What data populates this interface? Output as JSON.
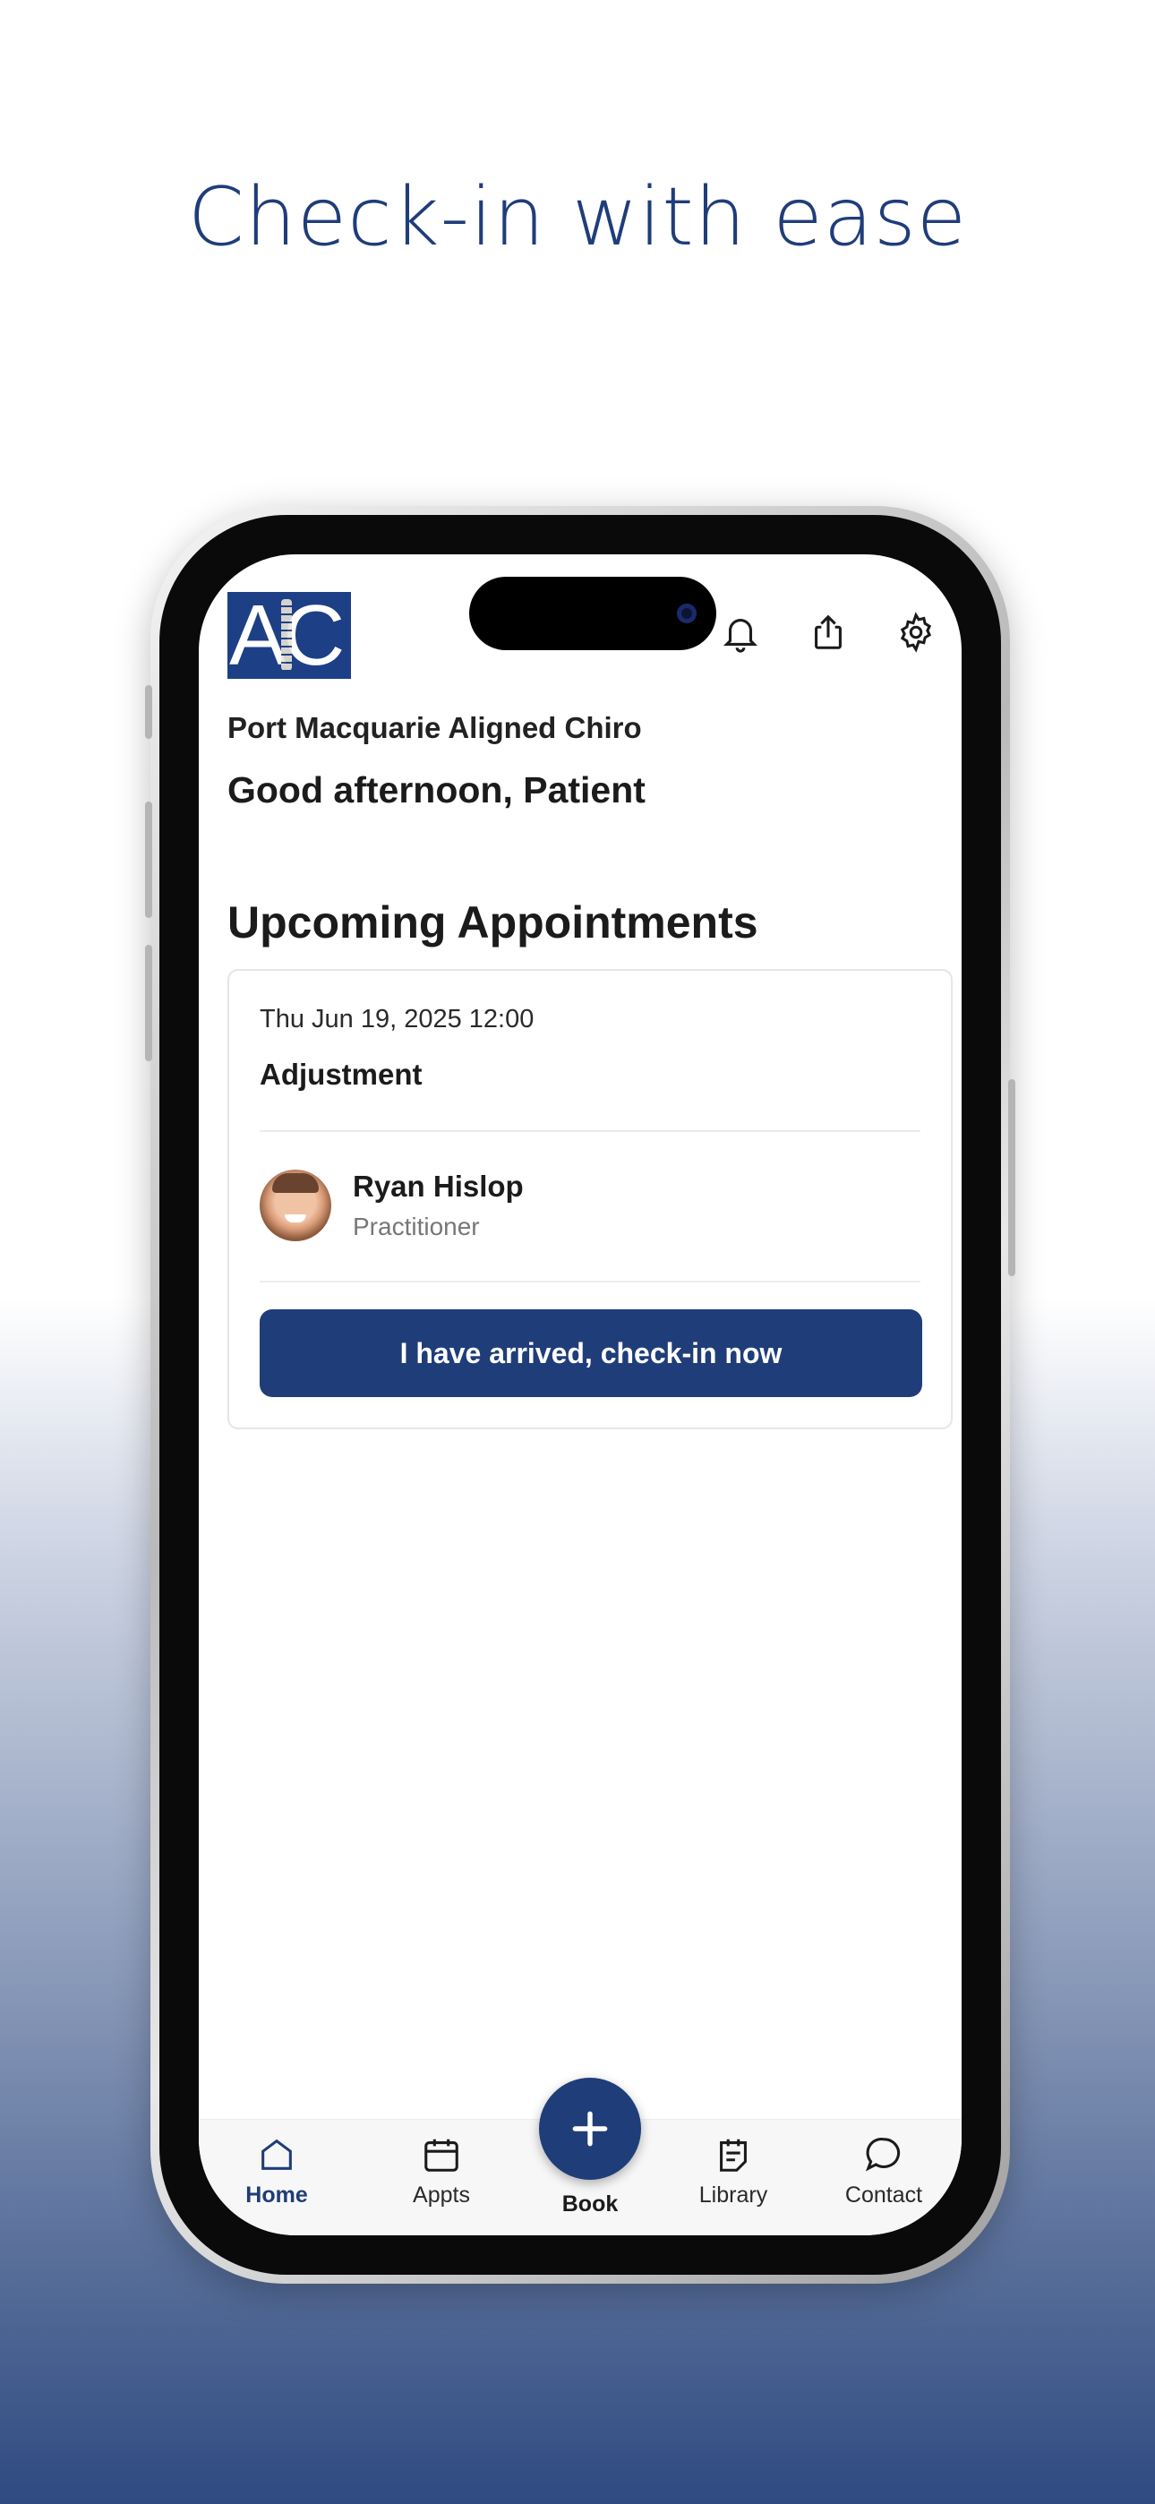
{
  "headline": "Check-in with ease",
  "colors": {
    "brand": "#1f3d78",
    "headline": "#1f3d7a",
    "background_bottom": "#2e4a80"
  },
  "header": {
    "logo_text": "AC",
    "icons": [
      "calendar-icon",
      "bell-icon",
      "share-icon",
      "gear-icon"
    ]
  },
  "clinic_name": "Port Macquarie Aligned Chiro",
  "greeting": "Good afternoon, Patient",
  "section_title": "Upcoming Appointments",
  "appointment": {
    "datetime": "Thu Jun 19, 2025 12:00",
    "type": "Adjustment",
    "practitioner_name": "Ryan Hislop",
    "practitioner_role": "Practitioner",
    "checkin_label": "I have arrived, check-in now"
  },
  "tabbar": {
    "home": "Home",
    "appts": "Appts",
    "book": "Book",
    "library": "Library",
    "contact": "Contact",
    "active": "Home"
  }
}
